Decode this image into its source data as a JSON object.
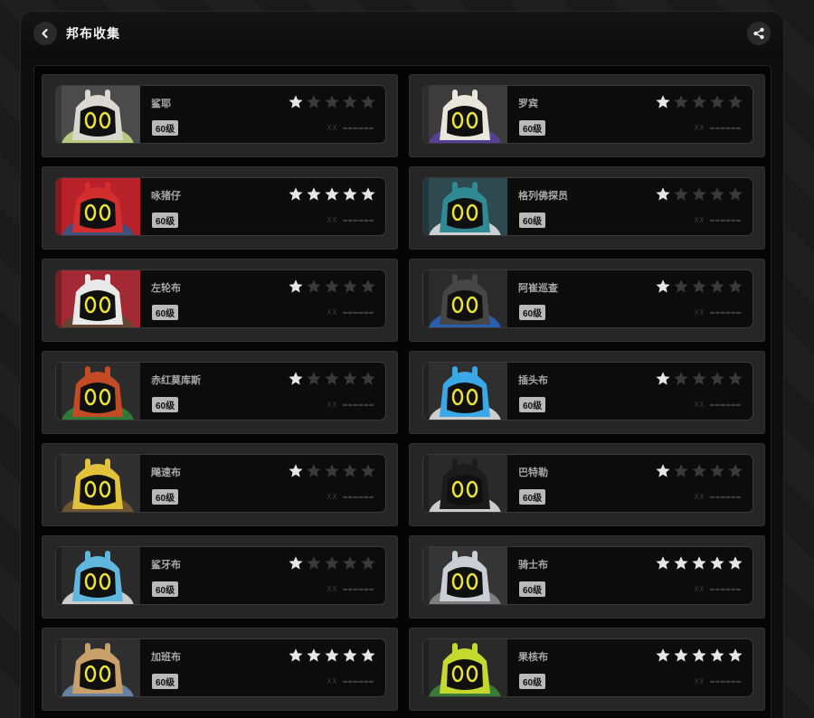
{
  "header": {
    "title": "邦布收集"
  },
  "level_label": "60级",
  "star_max": 5,
  "colors": {
    "star_on": "#e6e6e6",
    "star_off": "#3a3a3a"
  },
  "bangboos": [
    {
      "name": "鲨耶",
      "stars": 1,
      "code": "XX ▬▬▬▬▬▬",
      "palette": {
        "bg": "#4b4b4b",
        "body": "#d9d9d2",
        "accent": "#c9e08a"
      }
    },
    {
      "name": "罗宾",
      "stars": 1,
      "code": "XX ▬▬▬▬▬▬",
      "palette": {
        "bg": "#3c3c3c",
        "body": "#e9e6dc",
        "accent": "#5c3fa6"
      }
    },
    {
      "name": "咏猪仔",
      "stars": 5,
      "code": "XX ▬▬▬▬▬▬",
      "palette": {
        "bg": "#b8202a",
        "body": "#d32d2d",
        "accent": "#2a5b8c"
      }
    },
    {
      "name": "格列佛探员",
      "stars": 1,
      "code": "XX ▬▬▬▬▬▬",
      "palette": {
        "bg": "#2e4a50",
        "body": "#2f8a95",
        "accent": "#e7e7e7"
      }
    },
    {
      "name": "左轮布",
      "stars": 1,
      "code": "XX ▬▬▬▬▬▬",
      "palette": {
        "bg": "#a32a34",
        "body": "#e9e9e9",
        "accent": "#5b4a33"
      }
    },
    {
      "name": "阿崔巡查",
      "stars": 1,
      "code": "XX ▬▬▬▬▬▬",
      "palette": {
        "bg": "#2b2b2b",
        "body": "#464646",
        "accent": "#2c66c8"
      }
    },
    {
      "name": "赤红莫库斯",
      "stars": 1,
      "code": "XX ▬▬▬▬▬▬",
      "palette": {
        "bg": "#2c2c2c",
        "body": "#c24a24",
        "accent": "#2f8a3a"
      }
    },
    {
      "name": "插头布",
      "stars": 1,
      "code": "XX ▬▬▬▬▬▬",
      "palette": {
        "bg": "#2f2f2f",
        "body": "#3aa8e6",
        "accent": "#e9e9e9"
      }
    },
    {
      "name": "飚速布",
      "stars": 1,
      "code": "XX ▬▬▬▬▬▬",
      "palette": {
        "bg": "#303030",
        "body": "#e2c23a",
        "accent": "#7a5a35"
      }
    },
    {
      "name": "巴特勒",
      "stars": 1,
      "code": "XX ▬▬▬▬▬▬",
      "palette": {
        "bg": "#2a2a2a",
        "body": "#1c1c1c",
        "accent": "#e9e9e9"
      }
    },
    {
      "name": "鲨牙布",
      "stars": 1,
      "code": "XX ▬▬▬▬▬▬",
      "palette": {
        "bg": "#2a2a2a",
        "body": "#5fb6de",
        "accent": "#e9e9e9"
      }
    },
    {
      "name": "骑士布",
      "stars": 5,
      "code": "XX ▬▬▬▬▬▬",
      "palette": {
        "bg": "#353535",
        "body": "#c9cfd4",
        "accent": "#8c8c8c"
      }
    },
    {
      "name": "加班布",
      "stars": 5,
      "code": "XX ▬▬▬▬▬▬",
      "palette": {
        "bg": "#2f2f2f",
        "body": "#c9a06a",
        "accent": "#6f8fb8"
      }
    },
    {
      "name": "果核布",
      "stars": 5,
      "code": "XX ▬▬▬▬▬▬",
      "palette": {
        "bg": "#2a2a2a",
        "body": "#c4d82e",
        "accent": "#3a8a3a"
      }
    }
  ]
}
